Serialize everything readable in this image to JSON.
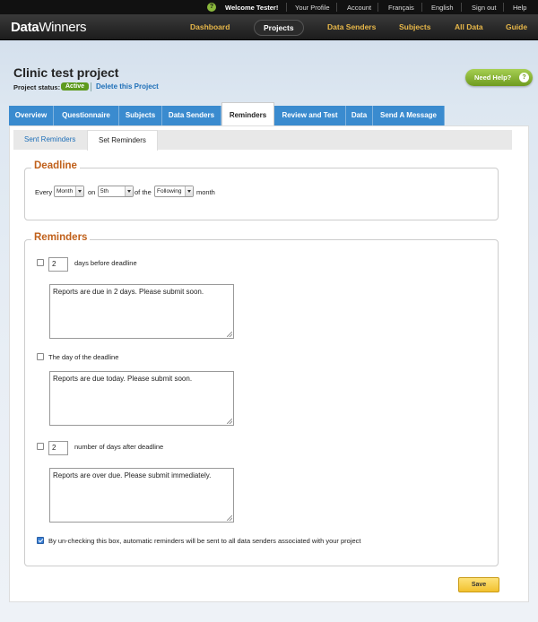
{
  "topbar": {
    "help_glyph": "?",
    "welcome": "Welcome Tester!",
    "links": [
      "Your Profile",
      "Account",
      "Français",
      "English",
      "Sign out",
      "Help"
    ]
  },
  "nav": {
    "logo_bold": "Data",
    "logo_rest": "Winners",
    "items": [
      "Dashboard",
      "Projects",
      "Data Senders",
      "Subjects",
      "All Data",
      "Guide"
    ],
    "active": "Projects"
  },
  "project": {
    "title": "Clinic test project",
    "status_label": "Project status:",
    "status": "Active",
    "delete_label": "Delete this Project",
    "need_help": "Need Help?",
    "need_help_icon": "?"
  },
  "tabs": [
    "Overview",
    "Questionnaire",
    "Subjects",
    "Data Senders",
    "Reminders",
    "Review and Test",
    "Data",
    "Send A Message"
  ],
  "active_tab": "Reminders",
  "subtabs": [
    "Sent Reminders",
    "Set Reminders"
  ],
  "active_subtab": "Set Reminders",
  "deadline": {
    "legend": "Deadline",
    "every": "Every",
    "frequency": "Month",
    "on": "on",
    "day": "5th",
    "of_the": "of the",
    "which": "Following",
    "month": "month"
  },
  "reminders": {
    "legend": "Reminders",
    "before": {
      "checked": false,
      "days": "2",
      "label": "days before deadline",
      "message": "Reports are due in 2 days. Please submit soon."
    },
    "on_day": {
      "checked": false,
      "label": "The day of the deadline",
      "message": "Reports are due today. Please submit soon."
    },
    "after": {
      "checked": false,
      "days": "2",
      "label": "number of days after deadline",
      "message": "Reports are over due. Please submit immediately."
    },
    "all_senders": {
      "checked": true,
      "label": "By un-checking this box, automatic reminders will be sent to all data senders associated with your project"
    }
  },
  "save_label": "Save",
  "colors": {
    "tab_blue": "#3a8bcf",
    "legend_orange": "#c0601a",
    "nav_gold": "#e8b84a",
    "active_green": "#5e9a1e",
    "help_green": "#8ab83c",
    "save_yellow": "#f2c12e"
  }
}
